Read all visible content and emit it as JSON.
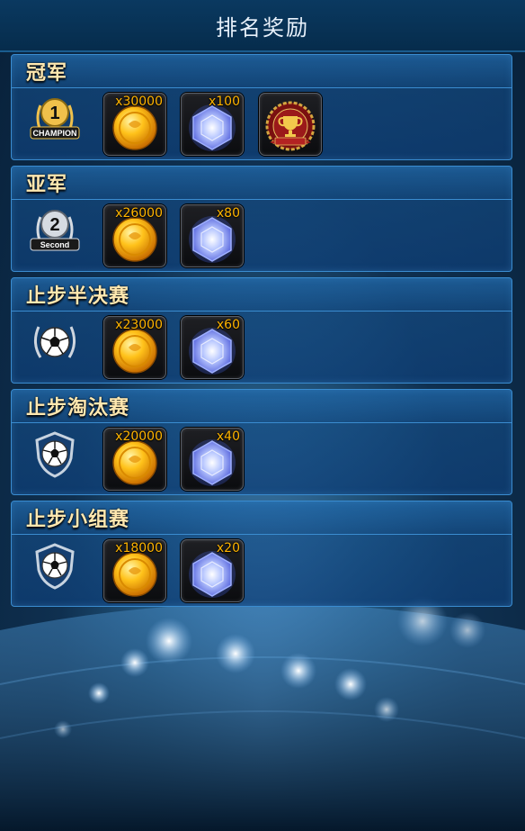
{
  "header": {
    "title": "排名奖励"
  },
  "ranks": [
    {
      "title": "冠军",
      "badge": {
        "number": "1",
        "label": "CHAMPION",
        "icon": "champion-medal-icon"
      },
      "rewards": [
        {
          "type": "gold-coin",
          "quantity": "x30000"
        },
        {
          "type": "blue-gem",
          "quantity": "x100"
        },
        {
          "type": "trophy-badge",
          "quantity": ""
        }
      ]
    },
    {
      "title": "亚军",
      "badge": {
        "number": "2",
        "label": "Second",
        "icon": "second-medal-icon"
      },
      "rewards": [
        {
          "type": "gold-coin",
          "quantity": "x26000"
        },
        {
          "type": "blue-gem",
          "quantity": "x80"
        }
      ]
    },
    {
      "title": "止步半决赛",
      "badge": {
        "icon": "laurel-football-icon"
      },
      "rewards": [
        {
          "type": "gold-coin",
          "quantity": "x23000"
        },
        {
          "type": "blue-gem",
          "quantity": "x60"
        }
      ]
    },
    {
      "title": "止步淘汰赛",
      "badge": {
        "icon": "shield-football-icon"
      },
      "rewards": [
        {
          "type": "gold-coin",
          "quantity": "x20000"
        },
        {
          "type": "blue-gem",
          "quantity": "x40"
        }
      ]
    },
    {
      "title": "止步小组赛",
      "badge": {
        "icon": "shield-football-icon"
      },
      "rewards": [
        {
          "type": "gold-coin",
          "quantity": "x18000"
        },
        {
          "type": "blue-gem",
          "quantity": "x20"
        }
      ]
    }
  ],
  "colors": {
    "quantity": "#ffb400",
    "title_text": "#ffe8b0",
    "panel_border": "#3a8cd0"
  }
}
